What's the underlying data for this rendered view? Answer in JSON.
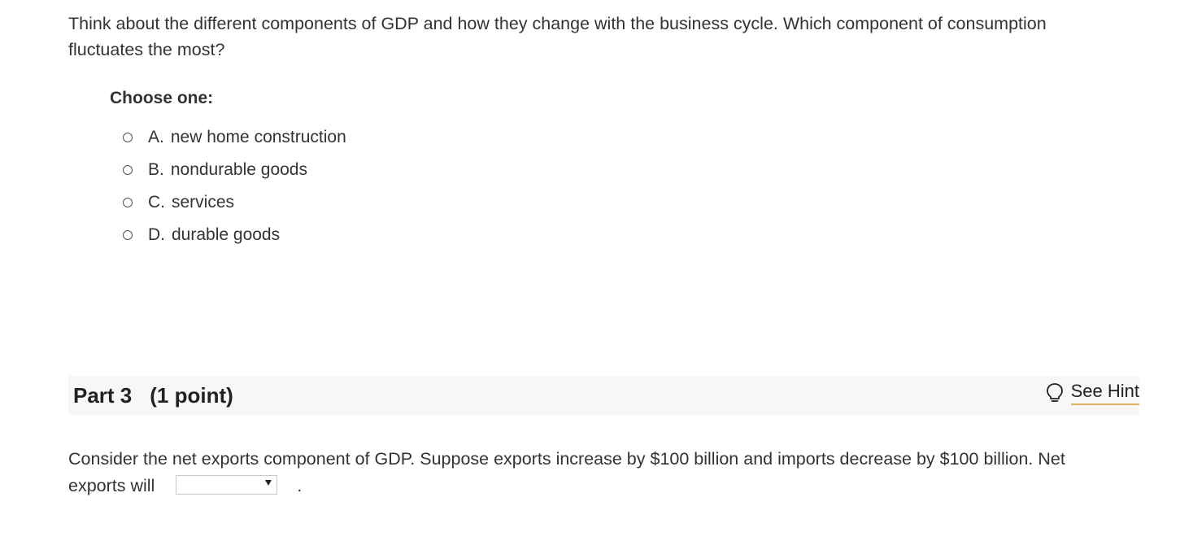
{
  "question1": {
    "text": "Think about the different components of GDP and how they change with the business cycle. Which component of consumption fluctuates the most?",
    "choose_label": "Choose one:",
    "options": [
      {
        "letter": "A.",
        "label": "new home construction"
      },
      {
        "letter": "B.",
        "label": "nondurable goods"
      },
      {
        "letter": "C.",
        "label": "services"
      },
      {
        "letter": "D.",
        "label": "durable goods"
      }
    ]
  },
  "part3": {
    "title": "Part 3",
    "points": "(1 point)",
    "hint_label": "See Hint",
    "hint_icon": "lightbulb-icon"
  },
  "question2": {
    "text_before": "Consider the net exports component of GDP. Suppose exports increase by $100 billion and imports decrease by $100 billion. Net exports will",
    "selected_value": "",
    "text_after": "."
  }
}
